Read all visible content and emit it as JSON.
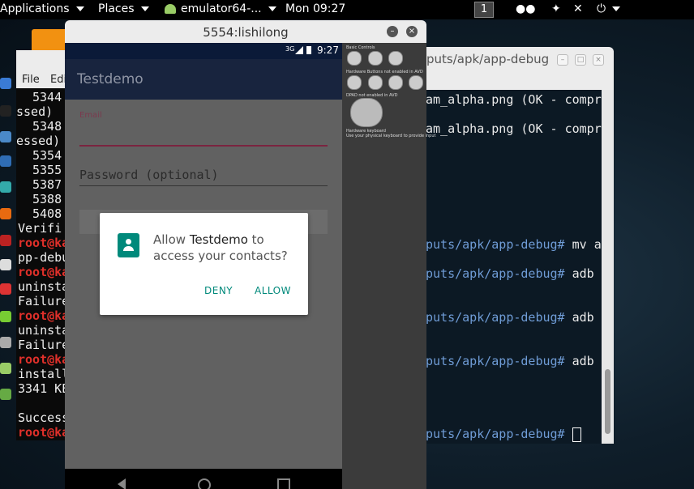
{
  "topbar": {
    "applications": "Applications",
    "places": "Places",
    "task": "emulator64-...",
    "clock": "Mon 09:27",
    "workspace": "1"
  },
  "left_terminal": {
    "menu_file": "File",
    "menu_edit": "Edi",
    "lines": [
      "5344",
      "ssed)",
      "5348",
      "essed)",
      "5354",
      "5355",
      "5387",
      "5388",
      "5408",
      "Verifi",
      "root@ka",
      "pp-debu",
      "root@ka",
      "uninsta",
      "Failure",
      "root@ka",
      "uninsta",
      "Failure",
      "root@ka",
      "install",
      "3341 KE",
      "",
      "Success",
      "root@ka"
    ]
  },
  "right_terminal": {
    "title": "puts/apk/app-debug",
    "lines": [
      {
        "prompt": "",
        "text": "am_alpha.png (OK - compre"
      },
      {
        "prompt": "",
        "text": "am_alpha.png (OK - compr"
      },
      {
        "prompt": "puts/apk/app-debug#",
        "text": " mv a"
      },
      {
        "prompt": "puts/apk/app-debug#",
        "text": " adb"
      },
      {
        "prompt": "puts/apk/app-debug#",
        "text": " adb"
      },
      {
        "prompt": "puts/apk/app-debug#",
        "text": " adb"
      },
      {
        "prompt": "puts/apk/app-debug#",
        "text": " "
      }
    ]
  },
  "emulator": {
    "window_title": "5554:lishilong",
    "status": {
      "network": "3G",
      "time": "9:27"
    },
    "app_title": "Testdemo",
    "email_label": "Email",
    "password_placeholder": "Password (optional)",
    "dialog": {
      "prefix": "Allow ",
      "app": "Testdemo",
      "suffix": " to access your contacts?",
      "deny": "DENY",
      "allow": "ALLOW"
    },
    "controls": {
      "basic": "Basic Controls",
      "hardware": "Hardware Buttons not enabled in AVD",
      "dpad": "DPAD not enabled in AVD",
      "keyboard": "Hardware keyboard",
      "keyboard_note": "Use your physical keyboard to provide input"
    }
  },
  "colors": {
    "accent": "#00897b",
    "prompt": "#6f9cd6",
    "root": "#e0302a",
    "appbar": "#18243e"
  }
}
